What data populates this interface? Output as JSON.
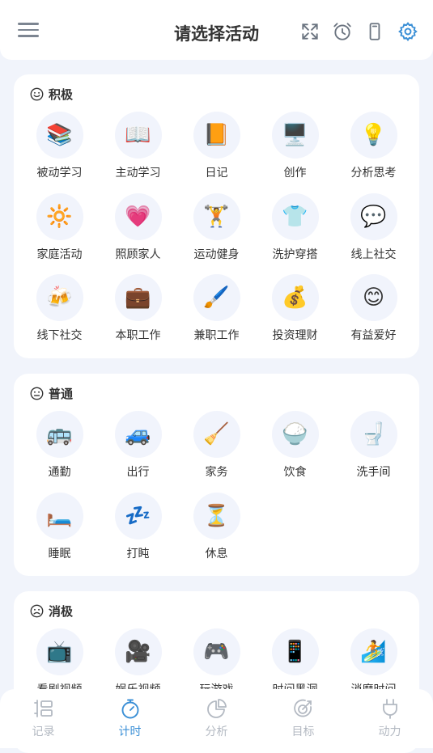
{
  "header": {
    "title": "请选择活动"
  },
  "sections": [
    {
      "title": "积极",
      "face": "smile",
      "items": [
        {
          "label": "被动学习",
          "icon": "📚"
        },
        {
          "label": "主动学习",
          "icon": "📖"
        },
        {
          "label": "日记",
          "icon": "📙"
        },
        {
          "label": "创作",
          "icon": "🖥️"
        },
        {
          "label": "分析思考",
          "icon": "💡"
        },
        {
          "label": "家庭活动",
          "icon": "🔆"
        },
        {
          "label": "照顾家人",
          "icon": "💗"
        },
        {
          "label": "运动健身",
          "icon": "🏋️"
        },
        {
          "label": "洗护穿搭",
          "icon": "👕"
        },
        {
          "label": "线上社交",
          "icon": "💬"
        },
        {
          "label": "线下社交",
          "icon": "🍻"
        },
        {
          "label": "本职工作",
          "icon": "💼"
        },
        {
          "label": "兼职工作",
          "icon": "🖌️"
        },
        {
          "label": "投资理财",
          "icon": "💰"
        },
        {
          "label": "有益爱好",
          "icon": "😊"
        }
      ]
    },
    {
      "title": "普通",
      "face": "neutral",
      "items": [
        {
          "label": "通勤",
          "icon": "🚌"
        },
        {
          "label": "出行",
          "icon": "🚙"
        },
        {
          "label": "家务",
          "icon": "🧹"
        },
        {
          "label": "饮食",
          "icon": "🍚"
        },
        {
          "label": "洗手间",
          "icon": "🚽"
        },
        {
          "label": "睡眠",
          "icon": "🛏️"
        },
        {
          "label": "打盹",
          "icon": "💤"
        },
        {
          "label": "休息",
          "icon": "⏳"
        }
      ]
    },
    {
      "title": "消极",
      "face": "sad",
      "items": [
        {
          "label": "看剧视频",
          "icon": "📺"
        },
        {
          "label": "娱乐视频",
          "icon": "🎥"
        },
        {
          "label": "玩游戏",
          "icon": "🎮"
        },
        {
          "label": "时间黑洞",
          "icon": "📱"
        },
        {
          "label": "消磨时间",
          "icon": "🏄"
        }
      ]
    }
  ],
  "tabs": [
    {
      "label": "记录",
      "icon": "list-icon"
    },
    {
      "label": "计时",
      "icon": "timer-icon",
      "active": true
    },
    {
      "label": "分析",
      "icon": "pie-chart-icon"
    },
    {
      "label": "目标",
      "icon": "target-icon"
    },
    {
      "label": "动力",
      "icon": "plug-icon"
    }
  ],
  "colors": {
    "accent": "#3a8fd6",
    "inactive": "#b3b9c2",
    "background": "#f1f4fb"
  }
}
